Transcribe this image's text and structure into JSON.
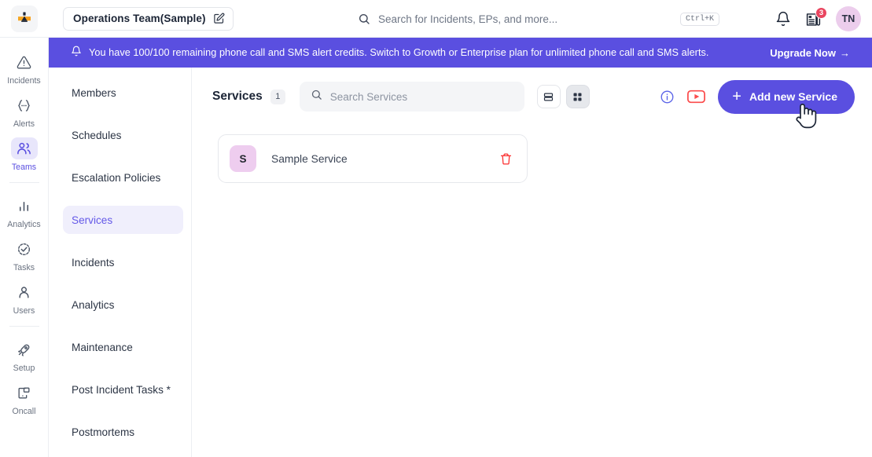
{
  "topbar": {
    "logo_icon": "zenduty-logo-icon",
    "team_name": "Operations Team(Sample)",
    "edit_icon": "edit-pencil-icon",
    "search_placeholder": "Search for Incidents, EPs, and more...",
    "search_value": "",
    "search_icon": "search-icon",
    "search_shortcut": "Ctrl+K",
    "bell_icon": "bell-icon",
    "docs_icon": "documents-icon",
    "docs_badge": "3",
    "avatar_initials": "TN"
  },
  "banner": {
    "icon": "bell-alert-icon",
    "message": "You have 100/100 remaining phone call and SMS alert credits. Switch to Growth or Enterprise plan for unlimited phone call and SMS alerts.",
    "cta_label": "Upgrade Now",
    "cta_arrow": "→",
    "bg_color": "#5a4fe0"
  },
  "rail": {
    "items": [
      {
        "label": "Incidents",
        "icon": "warning-triangle-icon",
        "active": false
      },
      {
        "label": "Alerts",
        "icon": "alert-braces-icon",
        "active": false
      },
      {
        "label": "Teams",
        "icon": "people-icon",
        "active": true
      },
      {
        "label": "Analytics",
        "icon": "bar-chart-icon",
        "active": false
      },
      {
        "label": "Tasks",
        "icon": "task-check-circle-icon",
        "active": false
      },
      {
        "label": "Users",
        "icon": "user-icon",
        "active": false
      },
      {
        "label": "Setup",
        "icon": "rocket-icon",
        "active": false
      },
      {
        "label": "Oncall",
        "icon": "oncall-screen-icon",
        "active": false
      }
    ]
  },
  "subnav": {
    "items": [
      {
        "label": "Members",
        "active": false
      },
      {
        "label": "Schedules",
        "active": false
      },
      {
        "label": "Escalation Policies",
        "active": false
      },
      {
        "label": "Services",
        "active": true
      },
      {
        "label": "Incidents",
        "active": false
      },
      {
        "label": "Analytics",
        "active": false
      },
      {
        "label": "Maintenance",
        "active": false
      },
      {
        "label": "Post Incident Tasks *",
        "active": false
      },
      {
        "label": "Postmortems",
        "active": false
      }
    ]
  },
  "main": {
    "title": "Services",
    "count": "1",
    "search_placeholder": "Search Services",
    "search_value": "",
    "search_icon": "search-icon",
    "list_view_icon": "list-view-icon",
    "grid_view_icon": "grid-view-icon",
    "info_icon": "info-circle-icon",
    "video_icon": "youtube-play-icon",
    "add_button_label": "Add new Service",
    "add_button_plus": "+",
    "accent_color": "#5a4fe0",
    "services": [
      {
        "initial": "S",
        "name": "Sample Service",
        "delete_icon": "trash-icon"
      }
    ]
  },
  "cursor": {
    "icon": "hand-pointer-cursor"
  }
}
